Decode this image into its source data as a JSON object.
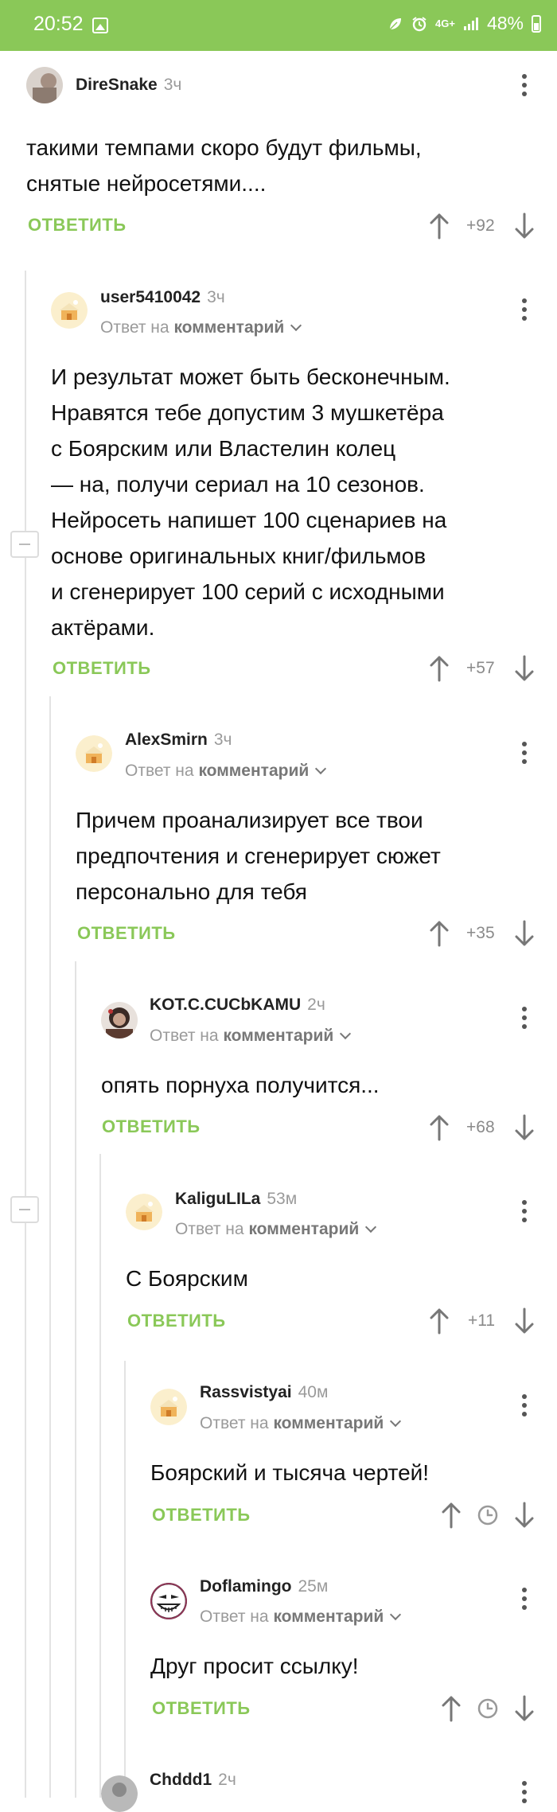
{
  "status_bar": {
    "time": "20:52",
    "network": "4G+",
    "battery": "48%"
  },
  "comments": [
    {
      "user": "DireSnake",
      "age": "3ч",
      "reply_prefix": "",
      "reply_target": "",
      "text": [
        "такими темпами скоро будут фильмы,",
        "снятые нейросетями...."
      ],
      "reply_label": "ОТВЕТИТЬ",
      "score": "+92"
    },
    {
      "user": "user5410042",
      "age": "3ч",
      "reply_prefix": "Ответ на",
      "reply_target": "комментарий",
      "text": [
        "И результат может быть бесконечным.",
        "Нравятся тебе допустим 3 мушкетёра",
        "с Боярским или Властелин колец",
        "— на, получи сериал на 10 сезонов.",
        "Нейросеть напишет 100 сценариев на",
        "основе оригинальных книг/фильмов",
        "и сгенерирует 100 серий с исходными",
        "актёрами."
      ],
      "reply_label": "ОТВЕТИТЬ",
      "score": "+57"
    },
    {
      "user": "AlexSmirn",
      "age": "3ч",
      "reply_prefix": "Ответ на",
      "reply_target": "комментарий",
      "text": [
        "Причем проанализирует все твои",
        "предпочтения и сгенерирует сюжет",
        "персонально для тебя"
      ],
      "reply_label": "ОТВЕТИТЬ",
      "score": "+35"
    },
    {
      "user": "KOT.C.CUCbKAMU",
      "age": "2ч",
      "reply_prefix": "Ответ на",
      "reply_target": "комментарий",
      "text": [
        "опять порнуха получится..."
      ],
      "reply_label": "ОТВЕТИТЬ",
      "score": "+68"
    },
    {
      "user": "KaliguLILa",
      "age": "53м",
      "reply_prefix": "Ответ на",
      "reply_target": "комментарий",
      "text": [
        "С Боярским"
      ],
      "reply_label": "ОТВЕТИТЬ",
      "score": "+11"
    },
    {
      "user": "Rassvistyai",
      "age": "40м",
      "reply_prefix": "Ответ на",
      "reply_target": "комментарий",
      "text": [
        "Боярский и тысяча чертей!"
      ],
      "reply_label": "ОТВЕТИТЬ",
      "score": ""
    },
    {
      "user": "Doflamingo",
      "age": "25м",
      "reply_prefix": "Ответ на",
      "reply_target": "комментарий",
      "text": [
        "Друг просит ссылку!"
      ],
      "reply_label": "ОТВЕТИТЬ",
      "score": ""
    },
    {
      "user": "Chddd1",
      "age": "2ч",
      "reply_prefix": "",
      "reply_target": "",
      "text": [],
      "reply_label": "",
      "score": ""
    }
  ],
  "icons": {
    "avatar_default": "gingerbread-house-icon",
    "up": "arrow-up-icon",
    "down": "arrow-down-icon",
    "pending": "clock-icon",
    "more": "kebab-menu-icon",
    "collapse": "collapse-minus-icon"
  },
  "colors": {
    "accent": "#8ac858",
    "muted": "#9a9a9a"
  }
}
